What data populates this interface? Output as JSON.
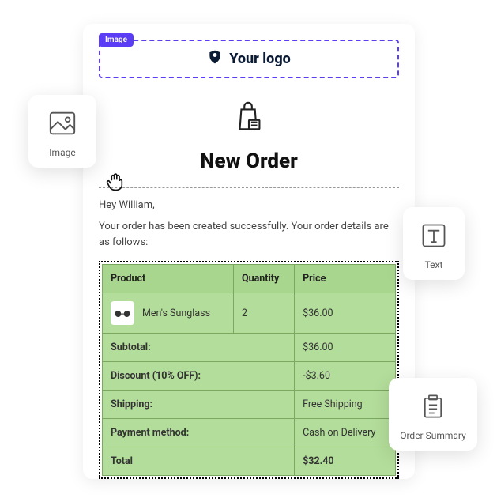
{
  "editor": {
    "selected_block_badge": "Image"
  },
  "logo": {
    "text": "Your logo"
  },
  "page": {
    "title": "New Order",
    "greeting": "Hey William,",
    "intro": "Your order has been created successfully. Your order details are as follows:"
  },
  "order": {
    "headers": {
      "product": "Product",
      "quantity": "Quantity",
      "price": "Price"
    },
    "items": [
      {
        "name": "Men's Sunglass",
        "qty": "2",
        "price": "$36.00"
      }
    ],
    "rows": {
      "subtotal_label": "Subtotal:",
      "subtotal_value": "$36.00",
      "discount_label": "Discount (10% OFF):",
      "discount_value": "-$3.60",
      "shipping_label": "Shipping:",
      "shipping_value": "Free Shipping",
      "payment_label": "Payment method:",
      "payment_value": "Cash on Delivery",
      "total_label": "Total",
      "total_value": "$32.40"
    }
  },
  "tools": {
    "image": "Image",
    "text": "Text",
    "order_summary": "Order Summary"
  }
}
